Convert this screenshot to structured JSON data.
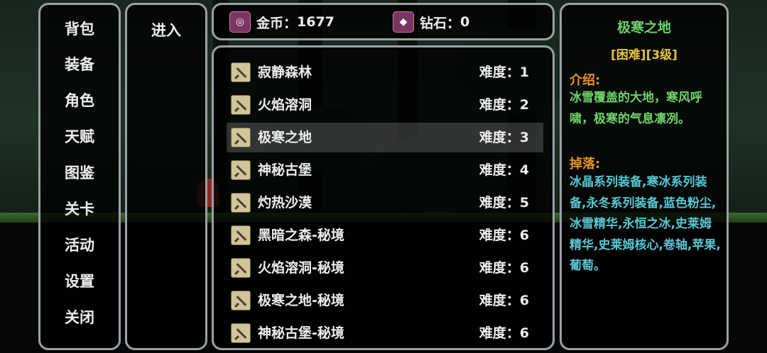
{
  "menu": {
    "items": [
      {
        "label": "背包"
      },
      {
        "label": "装备"
      },
      {
        "label": "角色"
      },
      {
        "label": "天赋"
      },
      {
        "label": "图鉴"
      },
      {
        "label": "关卡"
      },
      {
        "label": "活动"
      },
      {
        "label": "设置"
      },
      {
        "label": "关闭"
      }
    ]
  },
  "enter": {
    "label": "进入"
  },
  "currency": {
    "gold": {
      "icon": "gold-coin-icon",
      "label": "金币：",
      "value": "1677",
      "color": "#7a3560"
    },
    "diamond": {
      "icon": "diamond-icon",
      "label": "钻石：",
      "value": "0",
      "color": "#7a3560"
    }
  },
  "levels": {
    "selected_index": 2,
    "items": [
      {
        "name": "寂静森林",
        "difficulty_label": "难度：",
        "difficulty": "1"
      },
      {
        "name": "火焰溶洞",
        "difficulty_label": "难度：",
        "difficulty": "2"
      },
      {
        "name": "极寒之地",
        "difficulty_label": "难度：",
        "difficulty": "3"
      },
      {
        "name": "神秘古堡",
        "difficulty_label": "难度：",
        "difficulty": "4"
      },
      {
        "name": "灼热沙漠",
        "difficulty_label": "难度：",
        "difficulty": "5"
      },
      {
        "name": "黑暗之森-秘境",
        "difficulty_label": "难度：",
        "difficulty": "6"
      },
      {
        "name": "火焰溶洞-秘境",
        "difficulty_label": "难度：",
        "difficulty": "6"
      },
      {
        "name": "极寒之地-秘境",
        "difficulty_label": "难度：",
        "difficulty": "6"
      },
      {
        "name": "神秘古堡-秘境",
        "difficulty_label": "难度：",
        "difficulty": "6"
      }
    ]
  },
  "detail": {
    "title": "极寒之地",
    "tag": "[困难][3级]",
    "intro_header": "介绍:",
    "intro": "冰雪覆盖的大地，寒风呼啸，极寒的气息凛冽。",
    "drops_header": "掉落:",
    "drops": "冰晶系列装备,寒冰系列装备,永冬系列装备,蓝色粉尘,冰雪精华,永恒之冰,史莱姆精华,史莱姆核心,卷轴,苹果,葡萄。",
    "colors": {
      "title": "#6fd36a",
      "tag": "#e6c23d",
      "header": "#e8922b",
      "intro": "#6fd36a",
      "drops": "#59c7d3"
    }
  }
}
